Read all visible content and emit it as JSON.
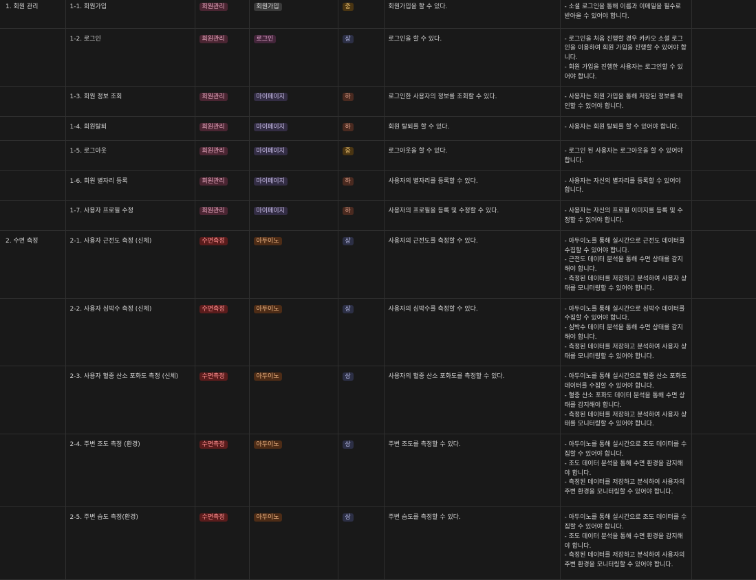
{
  "rows": [
    {
      "category": "1. 회원 관리",
      "feature": "1-1. 회원가입",
      "tag1": "회원관리",
      "tag1_class": "t-member",
      "tag2": "회원가입",
      "tag2_class": "t-signup",
      "priority": "중",
      "priority_class": "p-mid",
      "summary": "회원가입을 할 수 있다.",
      "detail": [
        "- 소셜 로그인을 통해 이름과 이메일을 필수로 받아올 수 있어야 합니다."
      ],
      "height": 41
    },
    {
      "category": "",
      "feature": "1-2. 로그인",
      "tag1": "회원관리",
      "tag1_class": "t-member",
      "tag2": "로그인",
      "tag2_class": "t-login",
      "priority": "상",
      "priority_class": "p-high",
      "summary": "로그인을 할 수 있다.",
      "detail": [
        "- 로그인을 처음 진행할 경우 카카오 소셜 로그인을 이용하여 회원 가입을 진행할 수 있어야 합니다.",
        "- 회원 가입을 진행한 사용자는 로그인할 수 있어야 합니다."
      ],
      "height": 77
    },
    {
      "category": "",
      "feature": "1-3. 회원 정보 조회",
      "tag1": "회원관리",
      "tag1_class": "t-member",
      "tag2": "마이페이지",
      "tag2_class": "t-mypage",
      "priority": "하",
      "priority_class": "p-low",
      "summary": "로그인한 사용자의 정보를 조회할 수 있다.",
      "detail": [
        "- 사용자는 회원 가입을 통해 저장된 정보를 확인할 수 있어야 합니다."
      ],
      "height": 36
    },
    {
      "category": "",
      "feature": "1-4. 회원탈퇴",
      "tag1": "회원관리",
      "tag1_class": "t-member",
      "tag2": "마이페이지",
      "tag2_class": "t-mypage",
      "priority": "하",
      "priority_class": "p-low",
      "summary": "회원 탈퇴를 할 수 있다.",
      "detail": [
        "- 사용자는 회원 탈퇴를 할 수 있어야 합니다."
      ],
      "height": 35
    },
    {
      "category": "",
      "feature": "1-5. 로그아웃",
      "tag1": "회원관리",
      "tag1_class": "t-member",
      "tag2": "마이페이지",
      "tag2_class": "t-mypage",
      "priority": "중",
      "priority_class": "p-mid",
      "summary": "로그아웃을 할 수 있다.",
      "detail": [
        "- 로그인 된 사용자는 로그아웃을 할 수 있어야 합니다."
      ],
      "height": 36
    },
    {
      "category": "",
      "feature": "1-6. 회원 별자리 등록",
      "tag1": "회원관리",
      "tag1_class": "t-member",
      "tag2": "마이페이지",
      "tag2_class": "t-mypage",
      "priority": "하",
      "priority_class": "p-low",
      "summary": "사용자의 별자리를 등록할 수 있다.",
      "detail": [
        "- 사용자는 자신의 별자리를 등록할 수 있어야 합니다."
      ],
      "height": 36
    },
    {
      "category": "",
      "feature": "1-7. 사용자 프로필 수정",
      "tag1": "회원관리",
      "tag1_class": "t-member",
      "tag2": "마이페이지",
      "tag2_class": "t-mypage",
      "priority": "하",
      "priority_class": "p-low",
      "summary": "사용자의 프로필을 등록 및 수정할 수 있다.",
      "detail": [
        "- 사용자는 자신의 프로필 이미지를 등록 및 수정할 수 있어야 합니다."
      ],
      "height": 35
    },
    {
      "category": "2. 수면 측정",
      "feature": "2-1. 사용자 근전도 측정 (신체)",
      "tag1": "수면측정",
      "tag1_class": "t-sleep",
      "tag2": "아두이노",
      "tag2_class": "t-arduino",
      "priority": "상",
      "priority_class": "p-high",
      "summary": "사용자의 근전도를 측정할 수 있다.",
      "detail": [
        "- 아두이노를 통해 실시간으로 근전도 데이터를 수집할 수 있어야 합니다.",
        "- 근전도 데이터 분석을 통해 수면 상태를 감지해야 합니다.",
        "- 측정된 데이터를 저장하고 분석하여 사용자 상태를 모니터링할 수 있어야 합니다."
      ],
      "height": 92
    },
    {
      "category": "",
      "feature": "2-2. 사용자 심박수 측정 (신체)",
      "tag1": "수면측정",
      "tag1_class": "t-sleep",
      "tag2": "아두이노",
      "tag2_class": "t-arduino",
      "priority": "상",
      "priority_class": "p-high",
      "summary": "사용자의 심박수를 측정할 수 있다.",
      "detail": [
        "- 아두이노를 통해 실시간으로 심박수 데이터를 수집할 수 있어야 합니다.",
        "- 심박수 데이터 분석을 통해 수면 상태를 감지해야 합니다.",
        "- 측정된 데이터를 저장하고 분석하여 사용자 상태를 모니터링할 수 있어야 합니다."
      ],
      "height": 91
    },
    {
      "category": "",
      "feature": "2-3. 사용자 혈중 산소 포화도 측정 (신체)",
      "tag1": "수면측정",
      "tag1_class": "t-sleep",
      "tag2": "아두이노",
      "tag2_class": "t-arduino",
      "priority": "상",
      "priority_class": "p-high",
      "summary": "사용자의 혈중 산소 포화도를 측정할 수 있다.",
      "detail": [
        "- 아두이노를 통해 실시간으로 혈중 산소 포화도 데이터를 수집할 수 있어야 합니다.",
        "- 혈중 산소 포화도 데이터 분석을 통해 수면 상태를 감지해야 합니다.",
        "- 측정된 데이터를 저장하고 분석하여 사용자 상태를 모니터링할 수 있어야 합니다."
      ],
      "height": 92
    },
    {
      "category": "",
      "feature": "2-4. 주변 조도 측정 (환경)",
      "tag1": "수면측정",
      "tag1_class": "t-sleep",
      "tag2": "아두이노",
      "tag2_class": "t-arduino",
      "priority": "상",
      "priority_class": "p-high",
      "summary": "주변 조도를 측정할 수 있다.",
      "detail": [
        "- 아두이노를 통해 실시간으로 조도 데이터를 수집할 수 있어야 합니다.",
        "- 조도 데이터 분석을 통해 수면 환경을 감지해야 합니다.",
        "- 측정된 데이터를 저장하고 분석하여 사용자의 주변 환경을 모니터링할 수 있어야 합니다."
      ],
      "height": 106
    },
    {
      "category": "",
      "feature": "2-5. 주변 습도 측정(환경)",
      "tag1": "수면측정",
      "tag1_class": "t-sleep",
      "tag2": "아두이노",
      "tag2_class": "t-arduino",
      "priority": "상",
      "priority_class": "p-high",
      "summary": "주변 습도를 측정할 수 있다.",
      "detail": [
        "- 아두이노를 통해 실시간으로 조도 데이터를 수집할 수 있어야 합니다.",
        "- 조도 데이터 분석을 통해 수면 환경을 감지해야 합니다.",
        "- 측정된 데이터를 저장하고 분석하여 사용자의 주변 환경을 모니터링할 수 있어야 합니다."
      ],
      "height": 106
    }
  ]
}
